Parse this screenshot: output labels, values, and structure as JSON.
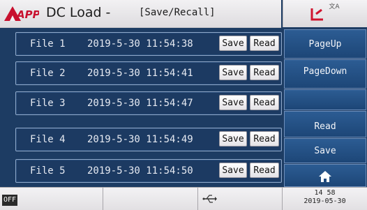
{
  "header": {
    "title": "DC Load -",
    "subtitle": "[Save/Recall]",
    "logo_text": "APP",
    "lang_icon_text": "文A",
    "brand_color": "#c8102e"
  },
  "files": [
    {
      "name": "File 1",
      "timestamp": "2019-5-30 11:54:38",
      "save_label": "Save",
      "read_label": "Read"
    },
    {
      "name": "File 2",
      "timestamp": "2019-5-30 11:54:41",
      "save_label": "Save",
      "read_label": "Read"
    },
    {
      "name": "File 3",
      "timestamp": "2019-5-30 11:54:47",
      "save_label": "Save",
      "read_label": "Read"
    },
    {
      "name": "File 4",
      "timestamp": "2019-5-30 11:54:49",
      "save_label": "Save",
      "read_label": "Read"
    },
    {
      "name": "File 5",
      "timestamp": "2019-5-30 11:54:50",
      "save_label": "Save",
      "read_label": "Read"
    }
  ],
  "side_panel": {
    "page_up": "PageUp",
    "page_down": "PageDown",
    "blank": "",
    "read": "Read",
    "save": "Save",
    "home_icon": "home-icon"
  },
  "status": {
    "output_state": "OFF",
    "usb_icon": "usb-icon",
    "time": "14 58",
    "date": "2019-05-30"
  }
}
